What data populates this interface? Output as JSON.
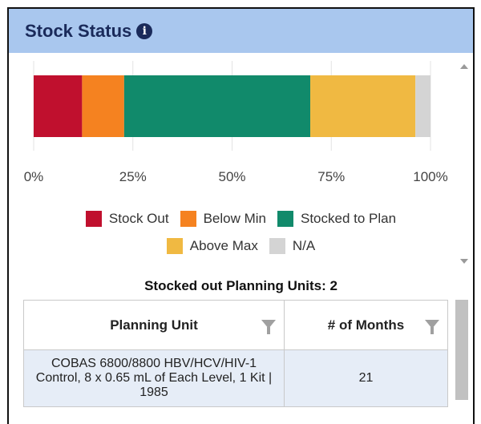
{
  "panel": {
    "title": "Stock Status"
  },
  "chart_data": {
    "type": "bar",
    "orientation": "horizontal",
    "stacked": true,
    "x_ticks": [
      "0%",
      "25%",
      "50%",
      "75%",
      "100%"
    ],
    "xlim": [
      0,
      100
    ],
    "grid": true,
    "legend_position": "bottom",
    "series": [
      {
        "name": "Stock Out",
        "value": 12.2,
        "color": "#c0102e"
      },
      {
        "name": "Below Min",
        "value": 10.6,
        "color": "#f58220"
      },
      {
        "name": "Stocked to Plan",
        "value": 46.9,
        "color": "#118a6b"
      },
      {
        "name": "Above Max",
        "value": 26.5,
        "color": "#f0b942"
      },
      {
        "name": "N/A",
        "value": 3.8,
        "color": "#d4d4d4"
      }
    ]
  },
  "summary": {
    "text": "Stocked out Planning Units: 2"
  },
  "table": {
    "headers": [
      "Planning Unit",
      "# of Months"
    ],
    "rows": [
      [
        "COBAS 6800/8800 HBV/HCV/HIV-1 Control, 8 x 0.65 mL of Each Level, 1 Kit | 1985",
        "21"
      ]
    ]
  }
}
